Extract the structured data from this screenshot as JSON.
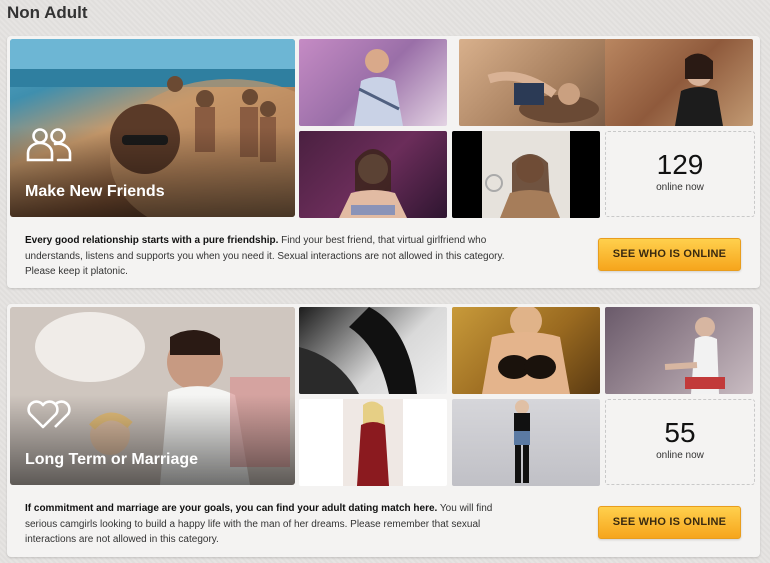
{
  "page_title": "Non Adult",
  "sections": [
    {
      "title": "Make New Friends",
      "icon": "friends-icon",
      "online_count": "129",
      "online_label": "online now",
      "desc_bold": "Every good relationship starts with a pure friendship.",
      "desc_rest": " Find your best friend, that virtual girlfriend who understands, listens and supports you when you need it. Sexual interactions are not allowed in this category. Please keep it platonic.",
      "cta": "SEE WHO IS ONLINE"
    },
    {
      "title": "Long Term or Marriage",
      "icon": "hearts-icon",
      "online_count": "55",
      "online_label": "online now",
      "desc_bold": "If commitment and marriage are your goals, you can find your adult dating match here.",
      "desc_rest": " You will find serious camgirls looking to build a happy life with the man of her dreams. Please remember that sexual interactions are not allowed in this category.",
      "cta": "SEE WHO IS ONLINE"
    }
  ]
}
